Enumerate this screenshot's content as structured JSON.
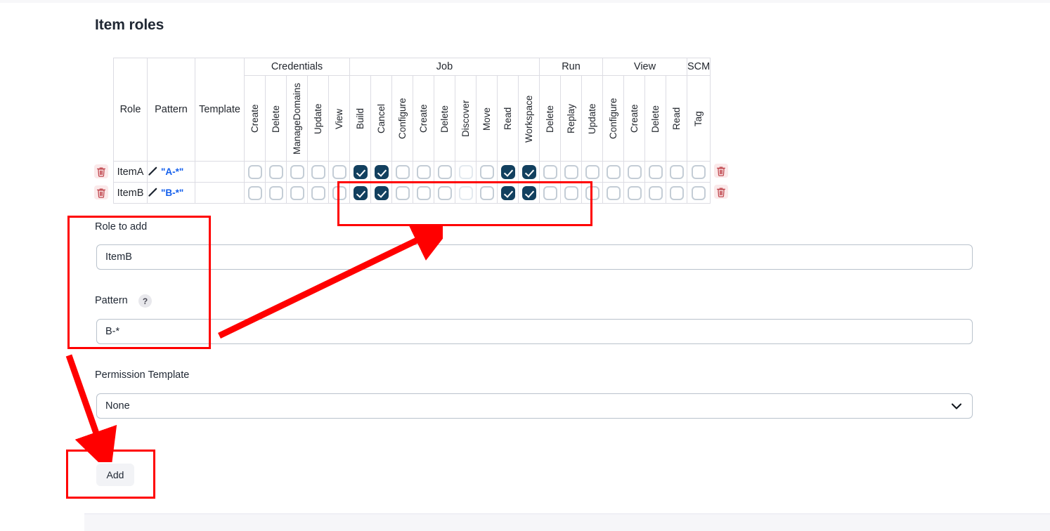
{
  "page": {
    "title": "Item roles"
  },
  "table": {
    "groups": [
      {
        "label": "",
        "span": 3
      },
      {
        "label": "Credentials",
        "span": 5
      },
      {
        "label": "Job",
        "span": 9
      },
      {
        "label": "Run",
        "span": 3
      },
      {
        "label": "View",
        "span": 4
      },
      {
        "label": "SCM",
        "span": 1
      }
    ],
    "fixed_headers": [
      "Role",
      "Pattern",
      "Template"
    ],
    "permission_columns": [
      "Create",
      "Delete",
      "ManageDomains",
      "Update",
      "View",
      "Build",
      "Cancel",
      "Configure",
      "Create",
      "Delete",
      "Discover",
      "Move",
      "Read",
      "Workspace",
      "Delete",
      "Replay",
      "Update",
      "Configure",
      "Create",
      "Delete",
      "Read",
      "Tag"
    ],
    "rows": [
      {
        "role": "ItemA",
        "pattern": "\"A-*\"",
        "template": "",
        "delete_icon": "trash-icon",
        "edit_icon": "pencil-icon",
        "checks": [
          false,
          false,
          false,
          false,
          false,
          true,
          true,
          false,
          false,
          false,
          "dim",
          false,
          true,
          true,
          false,
          false,
          false,
          false,
          false,
          false,
          false,
          false
        ]
      },
      {
        "role": "ItemB",
        "pattern": "\"B-*\"",
        "template": "",
        "delete_icon": "trash-icon",
        "edit_icon": "pencil-icon",
        "checks": [
          false,
          false,
          false,
          false,
          false,
          true,
          true,
          false,
          false,
          false,
          "dim",
          false,
          true,
          true,
          false,
          false,
          false,
          false,
          false,
          false,
          false,
          false
        ]
      }
    ]
  },
  "form": {
    "role_label": "Role to add",
    "role_value": "ItemB",
    "role_placeholder": "",
    "pattern_label": "Pattern",
    "pattern_help": "?",
    "pattern_value": "B-*",
    "pattern_placeholder": "",
    "template_label": "Permission Template",
    "template_value": "None",
    "template_chevron": "chevron-down-icon",
    "add_label": "Add"
  },
  "colors": {
    "accent_checked": "#12405f",
    "pattern_link": "#1560ec",
    "annotation": "#ff0000",
    "header_bg": "#f4f4f8",
    "border": "#dcdce3"
  }
}
